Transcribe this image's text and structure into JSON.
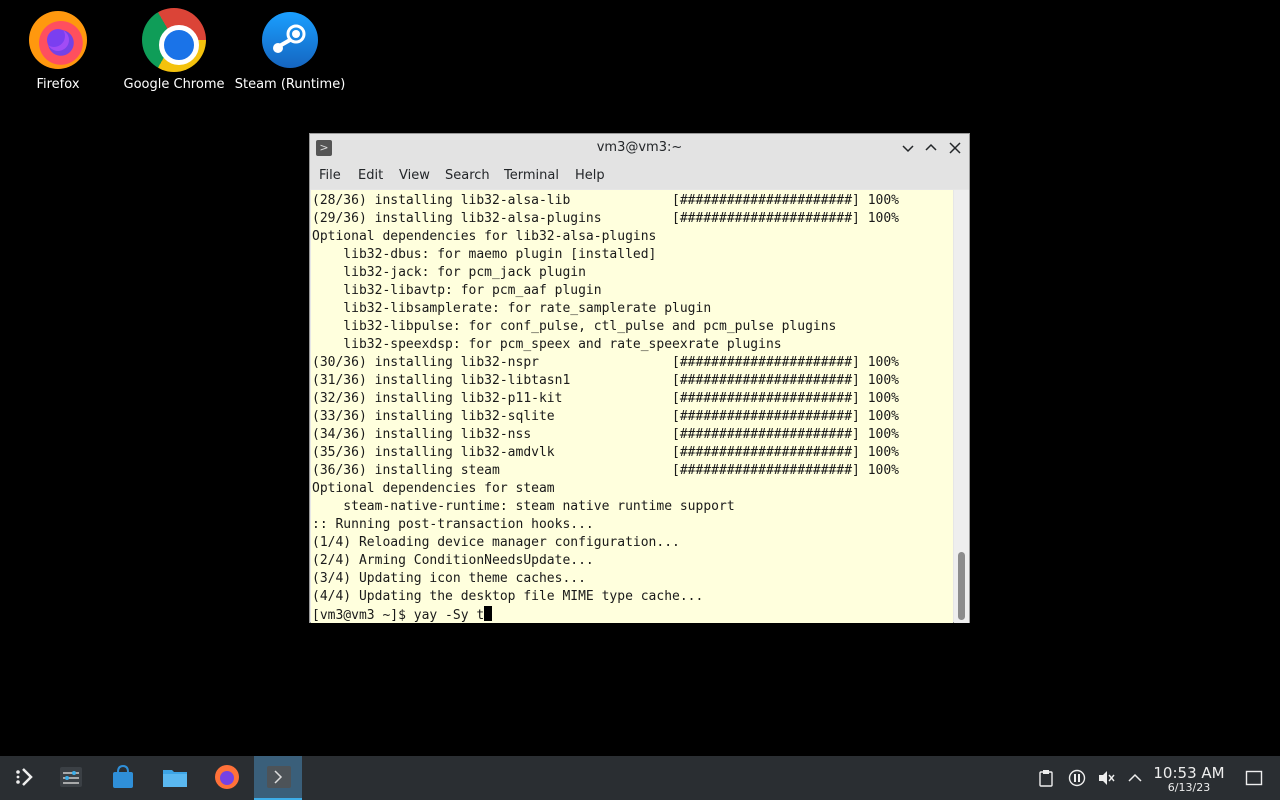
{
  "desktop": {
    "icons": [
      {
        "label": "Firefox",
        "icon": "firefox-icon"
      },
      {
        "label": "Google Chrome",
        "icon": "chrome-icon"
      },
      {
        "label": "Steam (Runtime)",
        "icon": "steam-icon"
      }
    ]
  },
  "terminal": {
    "title": "vm3@vm3:~",
    "menu": [
      "File",
      "Edit",
      "View",
      "Search",
      "Terminal",
      "Help"
    ],
    "lines": [
      "(28/36) installing lib32-alsa-lib             [######################] 100%",
      "(29/36) installing lib32-alsa-plugins         [######################] 100%",
      "Optional dependencies for lib32-alsa-plugins",
      "    lib32-dbus: for maemo plugin [installed]",
      "    lib32-jack: for pcm_jack plugin",
      "    lib32-libavtp: for pcm_aaf plugin",
      "    lib32-libsamplerate: for rate_samplerate plugin",
      "    lib32-libpulse: for conf_pulse, ctl_pulse and pcm_pulse plugins",
      "    lib32-speexdsp: for pcm_speex and rate_speexrate plugins",
      "(30/36) installing lib32-nspr                 [######################] 100%",
      "(31/36) installing lib32-libtasn1             [######################] 100%",
      "(32/36) installing lib32-p11-kit              [######################] 100%",
      "(33/36) installing lib32-sqlite               [######################] 100%",
      "(34/36) installing lib32-nss                  [######################] 100%",
      "(35/36) installing lib32-amdvlk               [######################] 100%",
      "(36/36) installing steam                      [######################] 100%",
      "Optional dependencies for steam",
      "    steam-native-runtime: steam native runtime support",
      ":: Running post-transaction hooks...",
      "(1/4) Reloading device manager configuration...",
      "(2/4) Arming ConditionNeedsUpdate...",
      "(3/4) Updating icon theme caches...",
      "(4/4) Updating the desktop file MIME type cache..."
    ],
    "prompt": "[vm3@vm3 ~]$ ",
    "command": "yay -Sy t"
  },
  "taskbar": {
    "time": "10:53 AM",
    "date": "6/13/23"
  },
  "colors": {
    "terminal_bg": "#ffffdd",
    "taskbar_bg": "#2a2e32",
    "active_task": "#3a5f7a"
  }
}
